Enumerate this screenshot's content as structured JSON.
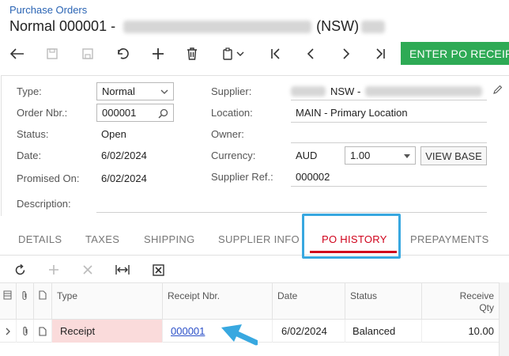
{
  "header": {
    "breadcrumb": "Purchase Orders",
    "title_prefix": "Normal 000001 -",
    "title_suffix": "(NSW)"
  },
  "toolbar": {
    "enter_receipt_label": "ENTER PO RECEIP"
  },
  "form": {
    "type_label": "Type:",
    "type_value": "Normal",
    "order_nbr_label": "Order Nbr.:",
    "order_nbr_value": "000001",
    "status_label": "Status:",
    "status_value": "Open",
    "date_label": "Date:",
    "date_value": "6/02/2024",
    "promised_on_label": "Promised On:",
    "promised_on_value": "6/02/2024",
    "description_label": "Description:",
    "supplier_label": "Supplier:",
    "supplier_value": "NSW -",
    "location_label": "Location:",
    "location_value": "MAIN - Primary Location",
    "owner_label": "Owner:",
    "currency_label": "Currency:",
    "currency_value": "AUD",
    "rate_value": "1.00",
    "view_base_label": "VIEW BASE",
    "supplier_ref_label": "Supplier Ref.:",
    "supplier_ref_value": "000002"
  },
  "tabs": [
    {
      "label": "DETAILS"
    },
    {
      "label": "TAXES"
    },
    {
      "label": "SHIPPING"
    },
    {
      "label": "SUPPLIER INFO"
    },
    {
      "label": "PO HISTORY"
    },
    {
      "label": "PREPAYMENTS"
    }
  ],
  "grid": {
    "columns": [
      "Type",
      "Receipt Nbr.",
      "Date",
      "Status",
      "Receive",
      "Qty"
    ],
    "rows": [
      {
        "type": "Receipt",
        "receipt_nbr": "000001",
        "date": "6/02/2024",
        "status": "Balanced",
        "qty": "10.00"
      }
    ]
  },
  "colors": {
    "accent_green": "#2eaa55",
    "active_tab_red": "#d0021b",
    "highlight_blue": "#38a8e0",
    "row_pink": "#fadbdb"
  }
}
